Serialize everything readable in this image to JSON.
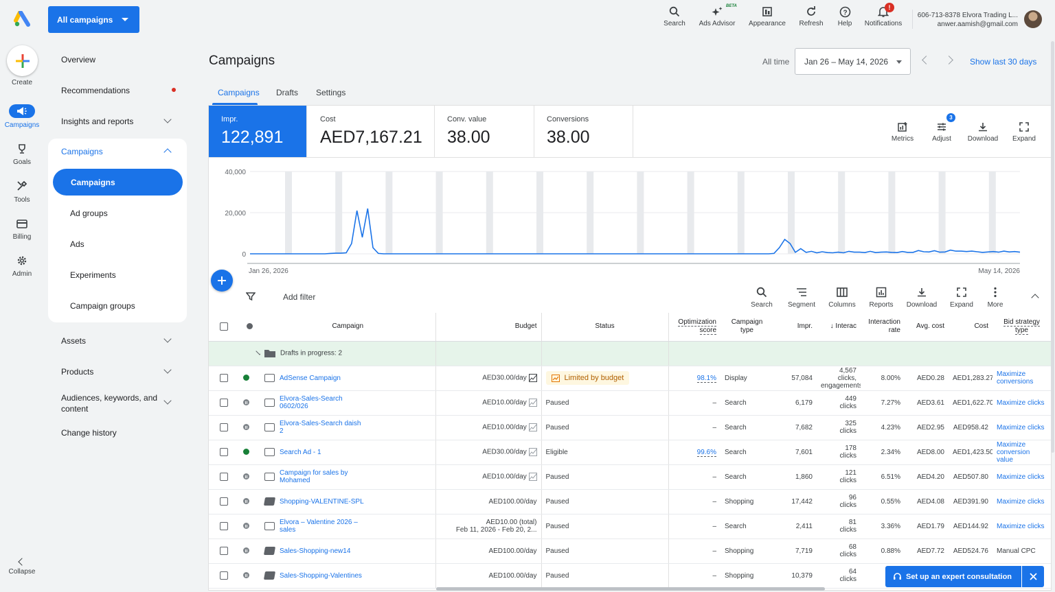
{
  "app": {
    "campaign_selector": "All campaigns"
  },
  "rail": {
    "create": "Create",
    "campaigns": "Campaigns",
    "goals": "Goals",
    "tools": "Tools",
    "billing": "Billing",
    "admin": "Admin",
    "collapse": "Collapse"
  },
  "nav": {
    "overview": "Overview",
    "recommendations": "Recommendations",
    "insights": "Insights and reports",
    "campaigns": "Campaigns",
    "sub": {
      "campaigns": "Campaigns",
      "ad_groups": "Ad groups",
      "ads": "Ads",
      "experiments": "Experiments",
      "campaign_groups": "Campaign groups"
    },
    "assets": "Assets",
    "products": "Products",
    "audiences_line1": "Audiences, keywords, and",
    "audiences_line2": "content",
    "change_history": "Change history"
  },
  "topbar": {
    "search": "Search",
    "ads_advisor": "Ads Advisor",
    "beta": "BETA",
    "appearance": "Appearance",
    "refresh": "Refresh",
    "help": "Help",
    "notifications": "Notifications",
    "notification_badge": "!",
    "account_line1": "606-713-8378 Elvora Trading L...",
    "account_line2": "anwer.aamish@gmail.com"
  },
  "page": {
    "title": "Campaigns",
    "all_time": "All time",
    "date_range": "Jan 26 – May 14, 2026",
    "show_last": "Show last 30 days",
    "tabs": [
      "Campaigns",
      "Drafts",
      "Settings"
    ]
  },
  "metrics": [
    {
      "label": "Impr.",
      "value": "122,891"
    },
    {
      "label": "Cost",
      "value": "AED7,167.21"
    },
    {
      "label": "Conv. value",
      "value": "38.00"
    },
    {
      "label": "Conversions",
      "value": "38.00"
    }
  ],
  "metric_actions": {
    "metrics": "Metrics",
    "adjust": "Adjust",
    "adjust_badge": "3",
    "download": "Download",
    "expand": "Expand"
  },
  "chart_data": {
    "type": "line",
    "series": [
      {
        "name": "Impr.",
        "values": [
          0,
          0,
          0,
          0,
          0,
          0,
          0,
          0,
          0,
          0,
          0,
          0,
          0,
          0,
          0,
          200,
          300,
          300,
          500,
          5000,
          21000,
          8000,
          22000,
          3000,
          200,
          0,
          0,
          0,
          0,
          0,
          0,
          0,
          0,
          0,
          0,
          0,
          0,
          0,
          0,
          0,
          0,
          0,
          0,
          0,
          0,
          0,
          0,
          0,
          0,
          0,
          0,
          0,
          0,
          0,
          0,
          0,
          0,
          0,
          0,
          0,
          0,
          0,
          0,
          0,
          0,
          0,
          0,
          0,
          0,
          0,
          0,
          0,
          0,
          0,
          0,
          0,
          0,
          0,
          0,
          0,
          0,
          0,
          0,
          0,
          0,
          0,
          0,
          0,
          0,
          0,
          0,
          0,
          0,
          0,
          0,
          0,
          0,
          0,
          200,
          3000,
          7000,
          5000,
          700,
          2500,
          700,
          1200,
          500,
          1000,
          600,
          500,
          800,
          500,
          1200,
          800,
          800,
          600,
          1200,
          600,
          800,
          900,
          700,
          600,
          1100,
          700,
          700,
          1600,
          1000,
          900,
          1500,
          800,
          900,
          1800,
          1300,
          1300,
          1100,
          1300,
          1000,
          700,
          900,
          1100,
          800,
          1300,
          900,
          1100,
          800
        ]
      }
    ],
    "x_start_label": "Jan 26, 2026",
    "x_end_label": "May 14, 2026",
    "y_ticks": [
      "40,000",
      "20,000",
      "0"
    ],
    "ylim": [
      0,
      40000
    ]
  },
  "toolbar": {
    "add_filter": "Add filter",
    "search": "Search",
    "segment": "Segment",
    "columns": "Columns",
    "reports": "Reports",
    "download": "Download",
    "expand": "Expand",
    "more": "More"
  },
  "table": {
    "headers": {
      "campaign": "Campaign",
      "budget": "Budget",
      "status": "Status",
      "opt_score": "Optimization score",
      "campaign_type": "Campaign type",
      "impr": "Impr.",
      "interactions": "Interac",
      "interaction_rate": "Interaction rate",
      "avg_cost": "Avg. cost",
      "cost": "Cost",
      "bid_strategy": "Bid strategy type"
    },
    "drafts_label": "Drafts in progress: 2",
    "rows": [
      {
        "name": "AdSense Campaign",
        "budget": "AED30.00/day",
        "status": "Limited by budget",
        "opt": "98.1%",
        "type": "Display",
        "impr": "57,084",
        "inter1": "4,567",
        "inter2": "clicks,",
        "inter3": "engagements",
        "rate": "8.00%",
        "avg": "AED0.28",
        "cost": "AED1,283.27",
        "bid": "Maximize conversions"
      },
      {
        "name": "Elvora-Sales-Search 0602/026",
        "budget": "AED10.00/day",
        "status": "Paused",
        "opt": "–",
        "type": "Search",
        "impr": "6,179",
        "inter1": "449",
        "inter2": "clicks",
        "rate": "7.27%",
        "avg": "AED3.61",
        "cost": "AED1,622.70",
        "bid": "Maximize clicks"
      },
      {
        "name": "Elvora-Sales-Search daish 2",
        "budget": "AED10.00/day",
        "status": "Paused",
        "opt": "–",
        "type": "Search",
        "impr": "7,682",
        "inter1": "325",
        "inter2": "clicks",
        "rate": "4.23%",
        "avg": "AED2.95",
        "cost": "AED958.42",
        "bid": "Maximize clicks"
      },
      {
        "name": "Search Ad - 1",
        "budget": "AED30.00/day",
        "status": "Eligible",
        "opt": "99.6%",
        "type": "Search",
        "impr": "7,601",
        "inter1": "178",
        "inter2": "clicks",
        "rate": "2.34%",
        "avg": "AED8.00",
        "cost": "AED1,423.50",
        "bid": "Maximize conversion value"
      },
      {
        "name": "Campaign for sales by Mohamed",
        "budget": "AED10.00/day",
        "status": "Paused",
        "opt": "–",
        "type": "Search",
        "impr": "1,860",
        "inter1": "121",
        "inter2": "clicks",
        "rate": "6.51%",
        "avg": "AED4.20",
        "cost": "AED507.80",
        "bid": "Maximize clicks"
      },
      {
        "name": "Shopping-VALENTINE-SPL",
        "budget": "AED100.00/day",
        "status": "Paused",
        "opt": "–",
        "type": "Shopping",
        "impr": "17,442",
        "inter1": "96",
        "inter2": "clicks",
        "rate": "0.55%",
        "avg": "AED4.08",
        "cost": "AED391.90",
        "bid": "Maximize clicks"
      },
      {
        "name": "Elvora – Valentine 2026 – sales",
        "budget": "AED10.00 (total)",
        "budget2": "Feb 11, 2026 - Feb 20, 2...",
        "status": "Paused",
        "opt": "–",
        "type": "Search",
        "impr": "2,411",
        "inter1": "81",
        "inter2": "clicks",
        "rate": "3.36%",
        "avg": "AED1.79",
        "cost": "AED144.92",
        "bid": "Maximize clicks"
      },
      {
        "name": "Sales-Shopping-new14",
        "budget": "AED100.00/day",
        "status": "Paused",
        "opt": "–",
        "type": "Shopping",
        "impr": "7,719",
        "inter1": "68",
        "inter2": "clicks",
        "rate": "0.88%",
        "avg": "AED7.72",
        "cost": "AED524.76",
        "bid": "Manual CPC"
      },
      {
        "name": "Sales-Shopping-Valentines",
        "budget": "AED100.00/day",
        "status": "Paused",
        "opt": "–",
        "type": "Shopping",
        "impr": "10,379",
        "inter1": "64",
        "inter2": "clicks",
        "rate": "",
        "avg": "",
        "cost": "",
        "bid": ""
      }
    ]
  },
  "consult": {
    "label": "Set up an expert consultation"
  }
}
